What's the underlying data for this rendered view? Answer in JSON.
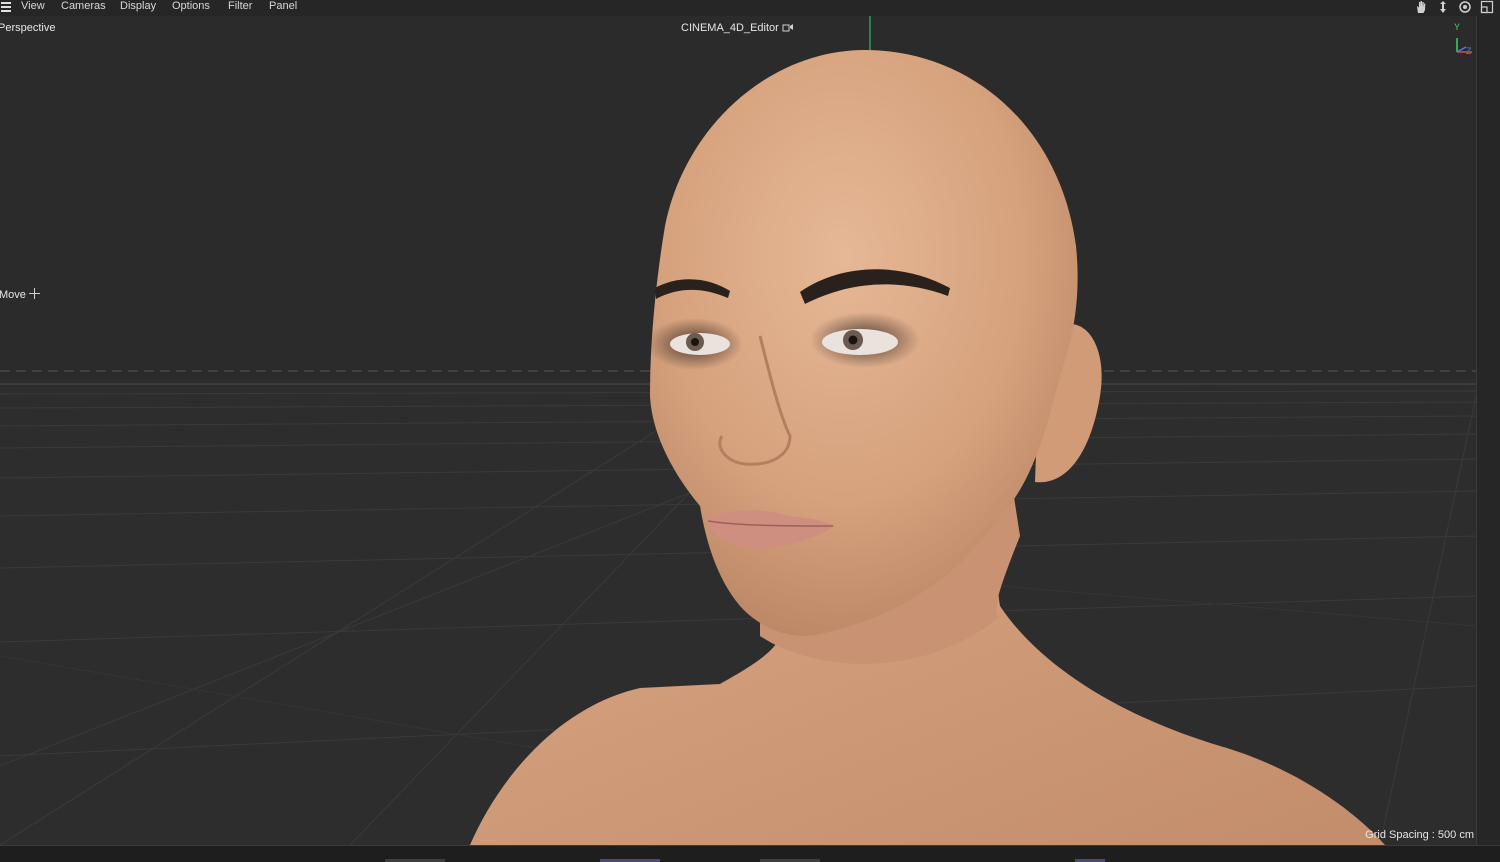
{
  "menubar": {
    "items": [
      "View",
      "Cameras",
      "Display",
      "Options",
      "Filter",
      "Panel"
    ]
  },
  "viewport": {
    "view_name": "Perspective",
    "camera_title": "CINEMA_4D_Editor",
    "tool_label": "Move",
    "grid_spacing": "Grid Spacing : 500 cm",
    "axis_labels": {
      "y": "Y",
      "z": "Z",
      "x": "X"
    }
  },
  "icons": {
    "menu": "hamburger-icon",
    "pan": "hand-pan-icon",
    "dolly": "move-arrows-icon",
    "rotate": "rotate-icon",
    "maximize": "maximize-icon",
    "camera_lock": "camera-lock-icon",
    "move_tool": "move-crosshair-icon"
  },
  "colors": {
    "axis_y": "#3ed36b",
    "axis_x": "#e04848",
    "axis_z": "#4a7fe0",
    "skin": "#d8a582",
    "background": "#2b2b2b"
  }
}
